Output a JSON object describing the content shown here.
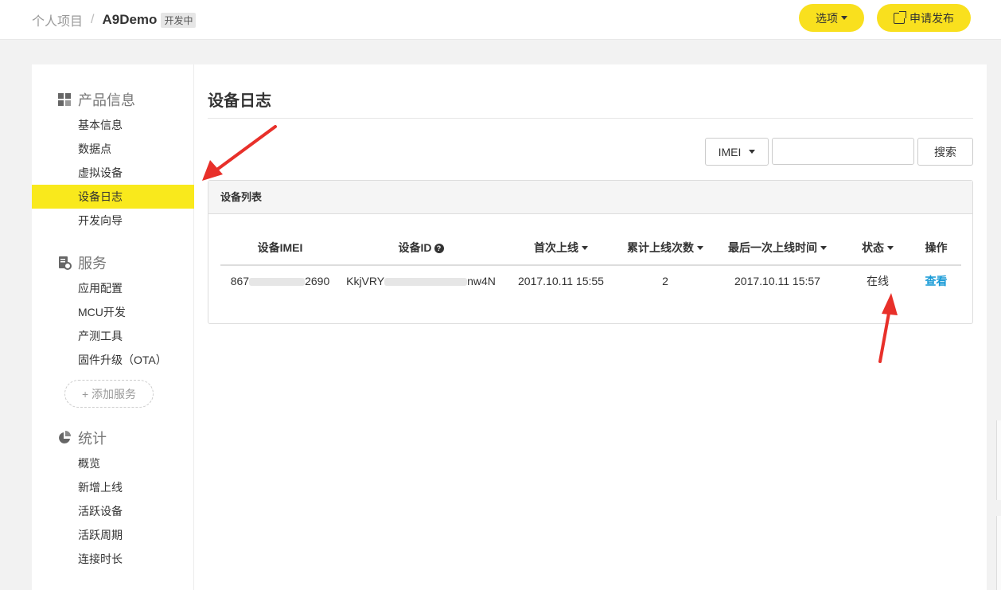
{
  "header": {
    "breadcrumb_root": "个人项目",
    "separator": "/",
    "project_name": "A9Demo",
    "status_badge": "开发中",
    "options_button": "选项",
    "publish_button": "申请发布"
  },
  "sidebar": {
    "sections": [
      {
        "title": "产品信息",
        "icon": "grid-icon",
        "items": [
          "基本信息",
          "数据点",
          "虚拟设备",
          "设备日志",
          "开发向导"
        ]
      },
      {
        "title": "服务",
        "icon": "service-gear-icon",
        "items": [
          "应用配置",
          "MCU开发",
          "产测工具",
          "固件升级（OTA）"
        ]
      },
      {
        "title": "统计",
        "icon": "pie-chart-icon",
        "items": [
          "概览",
          "新增上线",
          "活跃设备",
          "活跃周期",
          "连接时长"
        ]
      }
    ],
    "active_item": "设备日志",
    "add_service_label": "+ 添加服务"
  },
  "main": {
    "title": "设备日志",
    "filter_select": "IMEI",
    "search_value": "",
    "search_button": "搜索",
    "list_title": "设备列表",
    "columns": [
      "设备IMEI",
      "设备ID",
      "首次上线",
      "累计上线次数",
      "最后一次上线时间",
      "状态",
      "操作"
    ],
    "rows": [
      {
        "imei_start": "867",
        "imei_end": "2690",
        "id_start": "KkjVRY",
        "id_end": "nw4N",
        "first_online": "2017.10.11 15:55",
        "online_count": "2",
        "last_online": "2017.10.11 15:57",
        "status": "在线",
        "action": "查看"
      }
    ]
  },
  "colors": {
    "accent_yellow": "#f9e91c",
    "link_blue": "#1a9bd7",
    "annotation_red": "#e8302a"
  }
}
